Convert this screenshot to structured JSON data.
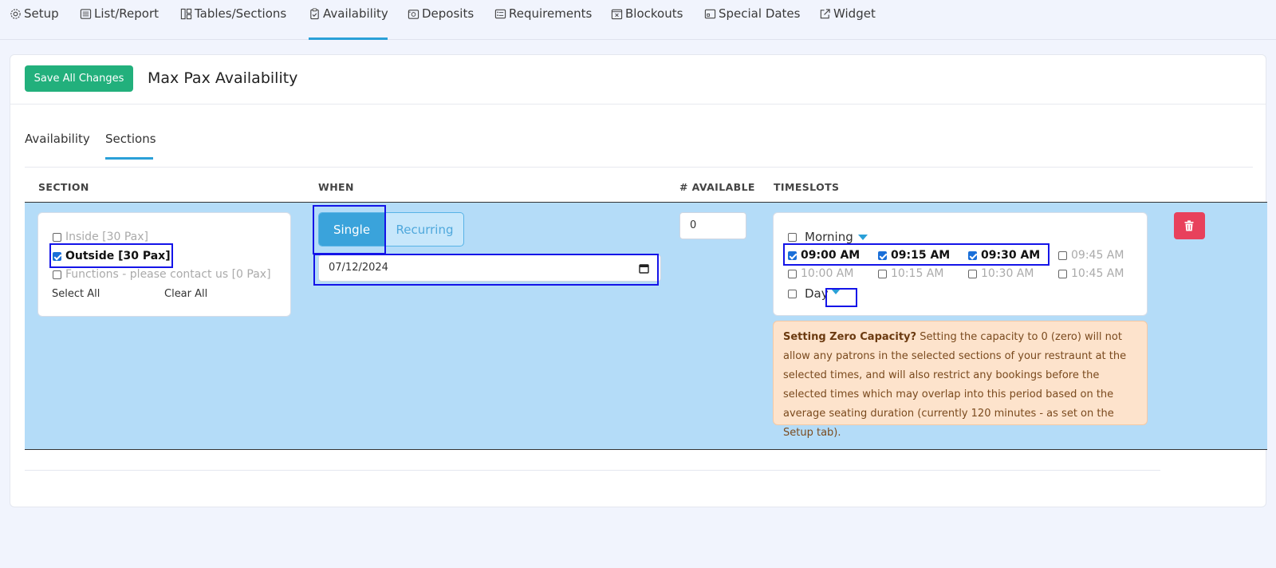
{
  "nav": {
    "items": [
      {
        "label": "Setup",
        "icon": "gear-icon"
      },
      {
        "label": "List/Report",
        "icon": "list-icon"
      },
      {
        "label": "Tables/Sections",
        "icon": "layout-icon"
      },
      {
        "label": "Availability",
        "icon": "clipboard-check-icon",
        "active": true
      },
      {
        "label": "Deposits",
        "icon": "deposit-icon"
      },
      {
        "label": "Requirements",
        "icon": "checklist-icon"
      },
      {
        "label": "Blockouts",
        "icon": "calendar-x-icon"
      },
      {
        "label": "Special Dates",
        "icon": "calendar-icon"
      },
      {
        "label": "Widget",
        "icon": "external-link-icon"
      }
    ]
  },
  "header": {
    "save_label": "Save All Changes",
    "title": "Max Pax Availability"
  },
  "subtabs": {
    "availability": "Availability",
    "sections": "Sections",
    "active": "Sections"
  },
  "table": {
    "headers": {
      "section": "SECTION",
      "when": "WHEN",
      "available": "# AVAILABLE",
      "timeslots": "TIMESLOTS"
    }
  },
  "sections": {
    "options": [
      {
        "label": "Inside [30 Pax]",
        "checked": false
      },
      {
        "label": "Outside [30 Pax]",
        "checked": true
      },
      {
        "label": "Functions - please contact us [0 Pax]",
        "checked": false
      }
    ],
    "select_all": "Select All",
    "clear_all": "Clear All"
  },
  "when": {
    "single_label": "Single",
    "recurring_label": "Recurring",
    "mode": "Single",
    "date_value": "07/12/2024"
  },
  "available": {
    "value": "0"
  },
  "timeslots": {
    "morning_label": "Morning",
    "day_label": "Day",
    "slots": [
      {
        "label": "09:00 AM",
        "checked": true
      },
      {
        "label": "09:15 AM",
        "checked": true
      },
      {
        "label": "09:30 AM",
        "checked": true
      },
      {
        "label": "09:45 AM",
        "checked": false
      },
      {
        "label": "10:00 AM",
        "checked": false
      },
      {
        "label": "10:15 AM",
        "checked": false
      },
      {
        "label": "10:30 AM",
        "checked": false
      },
      {
        "label": "10:45 AM",
        "checked": false
      }
    ]
  },
  "alert": {
    "heading": "Setting Zero Capacity?",
    "body": "Setting the capacity to 0 (zero) will not allow any patrons in the selected sections of your restraunt at the selected times, and will also restrict any bookings before the selected times which may overlap into this period based on the average seating duration (currently 120 minutes - as set on the Setup tab)."
  },
  "colors": {
    "accent": "#2aa0d8",
    "save_green": "#22b07c",
    "row_highlight": "#b4dcf8",
    "delete_red": "#e8415c",
    "alert_bg": "#fde3cc"
  }
}
